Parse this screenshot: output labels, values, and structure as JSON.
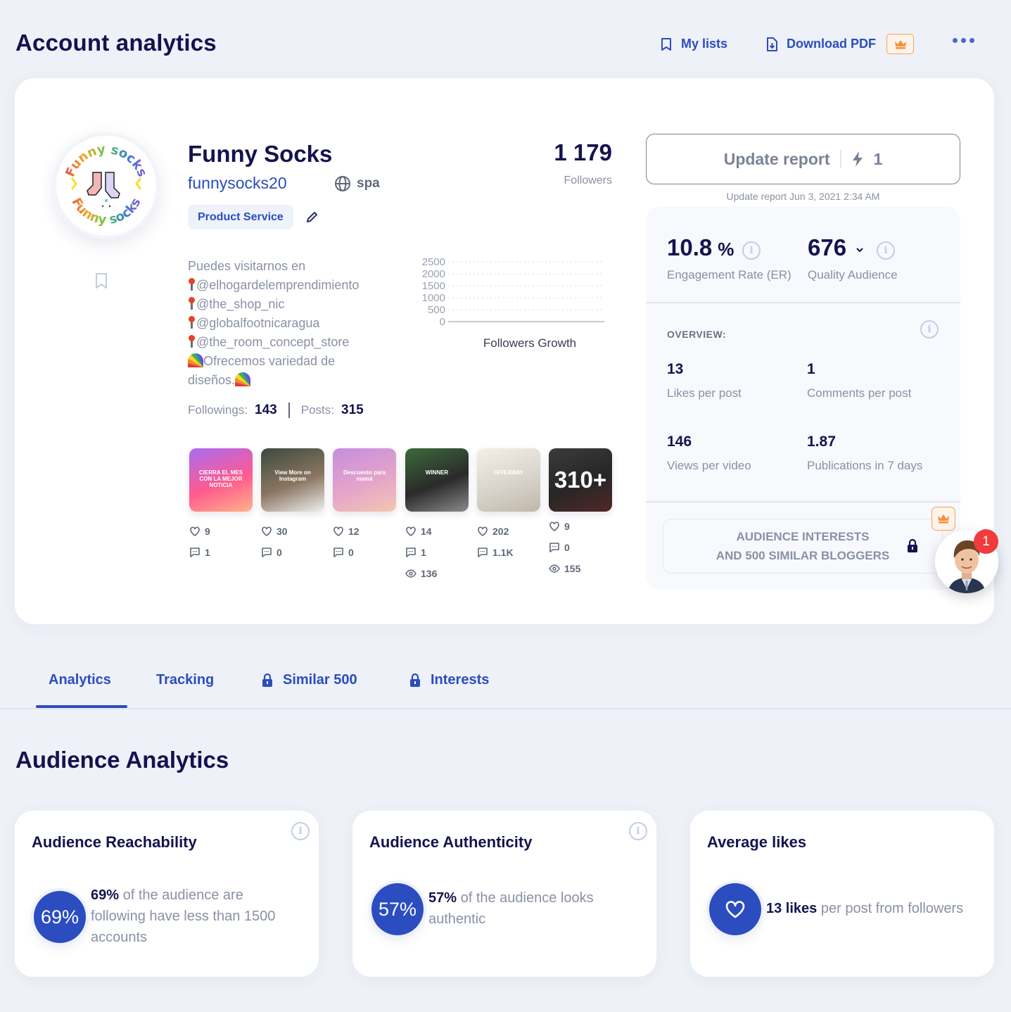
{
  "header": {
    "title": "Account analytics",
    "my_lists_label": "My lists",
    "download_pdf_label": "Download PDF"
  },
  "profile": {
    "name": "Funny Socks",
    "handle": "funnysocks20",
    "language": "spa",
    "category": "Product Service",
    "followers_value": "1 179",
    "followers_label": "Followers",
    "avatar_text_top": "Funny socks",
    "avatar_text_bottom": "Funny socks",
    "bio": {
      "line1": "Puedes visitarnos en",
      "links": [
        "@elhogardelemprendimiento",
        "@the_shop_nic",
        "@globalfootnicaragua",
        "@the_room_concept_store"
      ],
      "line6": "Ofrecemos variedad de",
      "line7": "diseños."
    },
    "followings_label": "Followings:",
    "followings_value": "143",
    "posts_label": "Posts:",
    "posts_value": "315"
  },
  "chart_data": {
    "type": "line",
    "title": "Followers Growth",
    "xlabel": "",
    "ylabel": "",
    "y_ticks": [
      "2500",
      "2000",
      "1500",
      "1000",
      "500",
      "0"
    ],
    "ylim": [
      0,
      2500
    ],
    "series": [],
    "grid": true
  },
  "posts": [
    {
      "likes": "9",
      "comments": "1",
      "views": null,
      "thumb_caption": "CIERRA EL MES CON LA MEJOR NOTICIA",
      "colors": [
        "#a86cf6",
        "#ff5a8f",
        "#ffb38a"
      ]
    },
    {
      "likes": "30",
      "comments": "0",
      "views": null,
      "thumb_caption": "View More on Instagram",
      "colors": [
        "#3b4a3e",
        "#8a7560",
        "#f0f0f0"
      ]
    },
    {
      "likes": "12",
      "comments": "0",
      "views": null,
      "thumb_caption": "Descuento para mamá",
      "colors": [
        "#c58ee0",
        "#e5a4c9",
        "#f3c6b2"
      ]
    },
    {
      "likes": "14",
      "comments": "1",
      "views": "136",
      "thumb_caption": "WINNER",
      "colors": [
        "#3c6b3c",
        "#2a2a2a",
        "#8b8b8b"
      ]
    },
    {
      "likes": "202",
      "comments": "1.1K",
      "views": null,
      "thumb_caption": "GIVEAWAY",
      "colors": [
        "#f4f0e6",
        "#d8d4cc",
        "#c0b8a8"
      ]
    },
    {
      "likes": "9",
      "comments": "0",
      "views": "155",
      "overlay": "310+",
      "colors": [
        "#6b6b6b",
        "#3d3d3d",
        "#a04040"
      ]
    }
  ],
  "update": {
    "button_label": "Update report",
    "credits": "1",
    "date_text": "Update report Jun 3, 2021 2:34 AM"
  },
  "stats": {
    "er_value": "10.8",
    "er_unit": "%",
    "er_label": "Engagement Rate (ER)",
    "qa_value": "676",
    "qa_label": "Quality Audience",
    "overview_heading": "OVERVIEW:",
    "overview": [
      {
        "value": "13",
        "label": "Likes per post"
      },
      {
        "value": "1",
        "label": "Comments per post"
      },
      {
        "value": "146",
        "label": "Views per video"
      },
      {
        "value": "1.87",
        "label": "Publications in 7 days"
      }
    ],
    "locked_line1": "AUDIENCE INTERESTS",
    "locked_line2": "AND 500 SIMILAR BLOGGERS"
  },
  "support": {
    "notification_count": "1"
  },
  "tabs": [
    {
      "label": "Analytics",
      "active": true,
      "locked": false
    },
    {
      "label": "Tracking",
      "active": false,
      "locked": false
    },
    {
      "label": "Similar 500",
      "active": false,
      "locked": true
    },
    {
      "label": "Interests",
      "active": false,
      "locked": true
    }
  ],
  "audience": {
    "section_title": "Audience Analytics",
    "reachability": {
      "title": "Audience Reachability",
      "percent": "69%",
      "text": " of the audience are following have less than 1500 accounts"
    },
    "authenticity": {
      "title": "Audience Authenticity",
      "percent": "57%",
      "text": " of the audience looks authentic"
    },
    "avg_likes": {
      "title": "Average likes",
      "value": "13 likes",
      "text": " per post from followers"
    }
  },
  "colors": {
    "accent": "#2b4dbf",
    "navy": "#14134f",
    "muted": "#8a90a6",
    "premium": "#f7a15a",
    "alert": "#f23b3b"
  }
}
